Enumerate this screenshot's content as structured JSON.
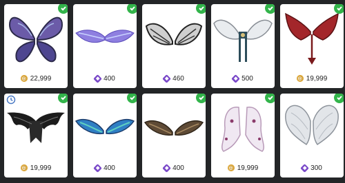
{
  "items": [
    {
      "name": "butterfly-wings",
      "price": "22,999",
      "currency": "gold",
      "owned": true,
      "limited": false
    },
    {
      "name": "pastel-wings",
      "price": "400",
      "currency": "purple",
      "owned": true,
      "limited": false
    },
    {
      "name": "mono-feather-wings",
      "price": "460",
      "currency": "purple",
      "owned": true,
      "limited": false
    },
    {
      "name": "seraph-wings",
      "price": "500",
      "currency": "purple",
      "owned": true,
      "limited": false
    },
    {
      "name": "demon-wings",
      "price": "19,999",
      "currency": "gold",
      "owned": true,
      "limited": false
    },
    {
      "name": "bat-wings",
      "price": "19,999",
      "currency": "gold",
      "owned": true,
      "limited": true
    },
    {
      "name": "blue-feather-wings",
      "price": "400",
      "currency": "purple",
      "owned": true,
      "limited": false
    },
    {
      "name": "brown-feather-wings",
      "price": "400",
      "currency": "purple",
      "owned": true,
      "limited": false
    },
    {
      "name": "ghost-wings",
      "price": "19,999",
      "currency": "gold",
      "owned": true,
      "limited": false
    },
    {
      "name": "crystal-wings",
      "price": "300",
      "currency": "purple",
      "owned": true,
      "limited": false
    }
  ],
  "colors": {
    "background": "#232527",
    "owned_check": "#32b44a",
    "gold_currency": "#c8911e",
    "purple_currency": "#7a49c9",
    "limited_icon": "#4a79c4"
  }
}
